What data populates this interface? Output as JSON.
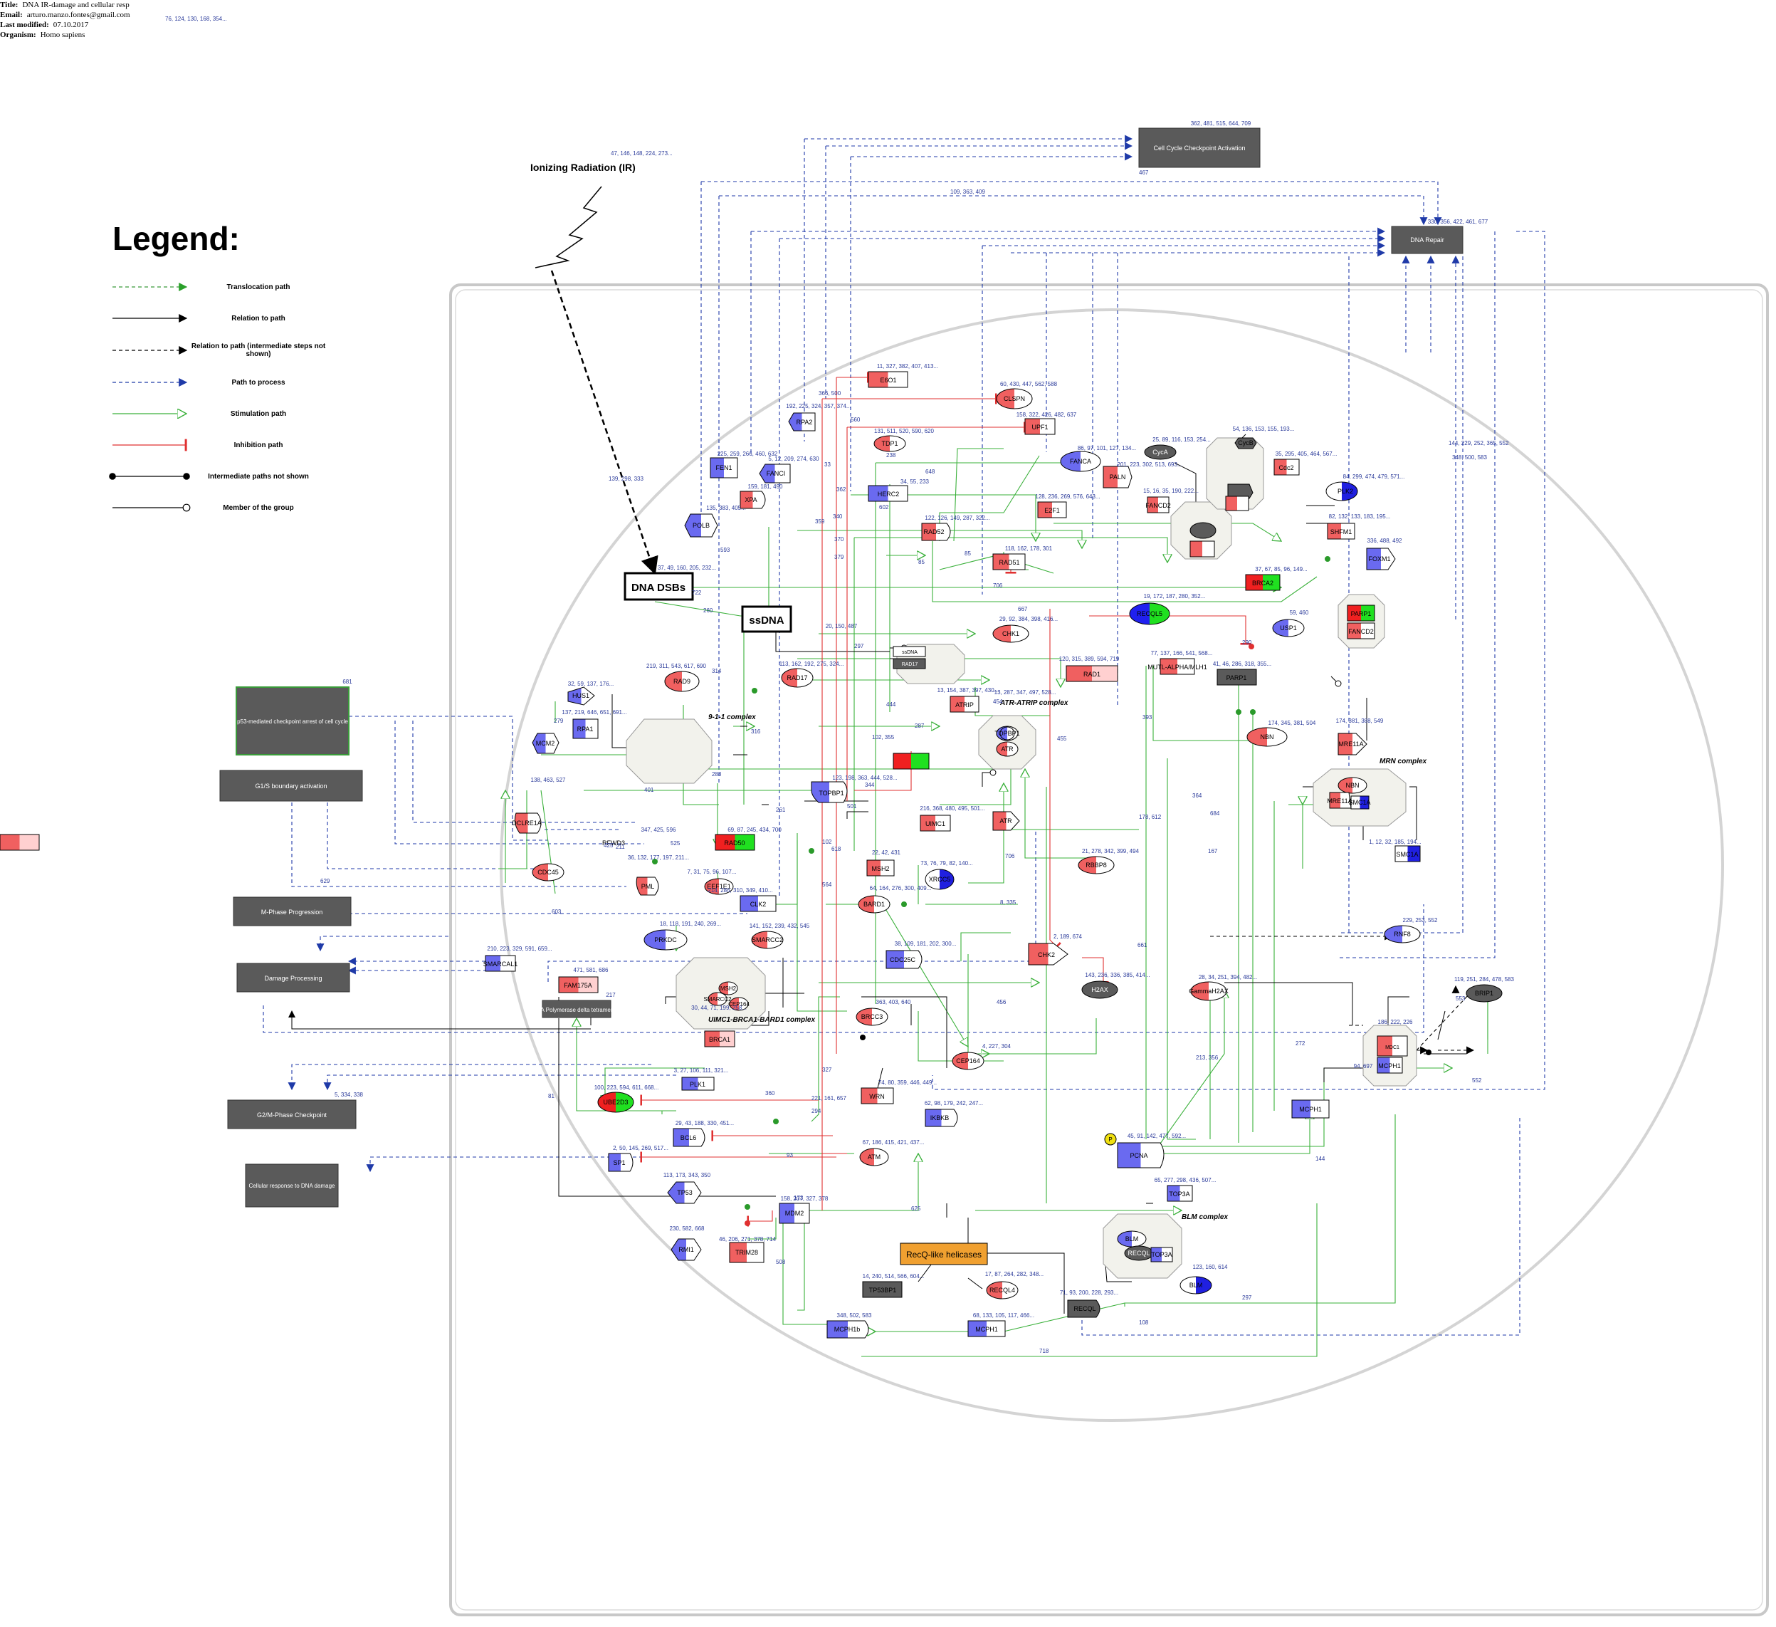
{
  "header": {
    "title_label": "Title:",
    "title": "DNA IR-damage and cellular resp",
    "email_label": "Email:",
    "email": "arturo.manzo.fontes@gmail.com",
    "modified_label": "Last modified:",
    "modified": "07.10.2017",
    "organism_label": "Organism:",
    "organism": "Homo sapiens",
    "refs": "76, 124, 130, 168, 354..."
  },
  "legend": {
    "title": "Legend:",
    "items": [
      {
        "label": "Translocation path"
      },
      {
        "label": "Relation to path"
      },
      {
        "label": "Relation to path (intermediate steps not shown)"
      },
      {
        "label": "Path to process"
      },
      {
        "label": "Stimulation path"
      },
      {
        "label": "Inhibition path"
      },
      {
        "label": "Intermediate paths not shown"
      },
      {
        "label": "Member of the group"
      }
    ]
  },
  "colors": {
    "translocation": "#3a9a3a",
    "relation": "#000000",
    "process": "#1f3aa8",
    "stimulation": "#3ab03a",
    "inhibition": "#e03030",
    "process_box": "#5a5a5a",
    "red_node": "#f06060",
    "blue_node": "#6a6af0",
    "green_node": "#20e020",
    "ref_text": "#2a3a9a"
  },
  "stimulus": {
    "label": "Ionizing Radiation (IR)",
    "refs": "47, 146, 148, 224, 273..."
  },
  "processes": [
    {
      "label": "Cell Cycle Checkpoint Activation",
      "refs": "362, 481, 515, 644, 709"
    },
    {
      "label": "DNA Repair",
      "refs": "330, 356, 422, 461, 677"
    },
    {
      "label": "p53-mediated checkpoint arrest of cell cycle",
      "refs": "681"
    },
    {
      "label": "G1/S boundary activation",
      "refs": ""
    },
    {
      "label": "M-Phase Progression",
      "refs": ""
    },
    {
      "label": "Damage Processing",
      "refs": ""
    },
    {
      "label": "G2/M-Phase Checkpoint",
      "refs": "5, 334, 338"
    },
    {
      "label": "Cellular response to DNA damage",
      "refs": ""
    },
    {
      "label": "A Polymerase delta tetramer",
      "refs": "217"
    }
  ],
  "key_nodes": [
    {
      "label": "DNA DSBs",
      "refs": "37, 49, 160, 205, 232..."
    },
    {
      "label": "ssDNA",
      "refs": ""
    },
    {
      "label": "RecQ-like helicases",
      "refs": ""
    }
  ],
  "genes": [
    {
      "label": "E2F1",
      "refs": "128, 236, 269, 576, 643..."
    },
    {
      "label": "E6O1",
      "refs": "11, 327, 382, 407, 413..."
    },
    {
      "label": "CLSPN",
      "refs": "60, 430, 447, 562, 588"
    },
    {
      "label": "UPF1",
      "refs": "158, 322, 426, 482, 637"
    },
    {
      "label": "RPA2",
      "refs": "192, 225, 324, 357, 374..."
    },
    {
      "label": "TDP1",
      "refs": "131, 511, 520, 590, 620"
    },
    {
      "label": "FEN1",
      "refs": "225, 259, 266, 460, 632"
    },
    {
      "label": "FANCI",
      "refs": "5, 12, 209, 274, 630"
    },
    {
      "label": "FANCA",
      "refs": "86, 97, 101, 127, 134..."
    },
    {
      "label": "PALN",
      "refs": "201, 223, 302, 513, 693..."
    },
    {
      "label": "HERC2",
      "refs": "34, 55, 233"
    },
    {
      "label": "XPA",
      "refs": "159, 181, 490"
    },
    {
      "label": "POLB",
      "refs": "135, 383, 405..."
    },
    {
      "label": "RAD52",
      "refs": "122, 126, 149, 287, 322..."
    },
    {
      "label": "RAD51",
      "refs": "118, 162, 178, 301"
    },
    {
      "label": "CHK1",
      "refs": "29, 92, 384, 398, 416..."
    },
    {
      "label": "RECQL5",
      "refs": "19, 172, 187, 280, 352..."
    },
    {
      "label": "USP1",
      "refs": "59, 460"
    },
    {
      "label": "BRCA2",
      "refs": "37, 67, 85, 96, 149..."
    },
    {
      "label": "FOXM1",
      "refs": "336, 488, 492"
    },
    {
      "label": "SHFM1",
      "refs": "82, 132, 133, 183, 195..."
    },
    {
      "label": "PLK2",
      "refs": "84, 299, 474, 479, 571..."
    },
    {
      "label": "Cdc2",
      "refs": "35, 295, 405, 464, 567..."
    },
    {
      "label": "CycA",
      "refs": "25, 89, 116, 153, 254..."
    },
    {
      "label": "CycB",
      "refs": "54, 136, 153, 155, 193..."
    },
    {
      "label": "Cdk2",
      "refs": "15, 16, 35, 190, 222..."
    },
    {
      "label": "FANCD2",
      "refs": "41, 46, 286, 318, 355..."
    },
    {
      "label": "PARP1",
      "refs": "77, 137, 166, 541, 568..."
    },
    {
      "label": "MUTL-ALPHA/MLH1",
      "refs": "120, 315, 389, 594, 719"
    },
    {
      "label": "RAD1",
      "refs": "219, 311, 543, 617, 690"
    },
    {
      "label": "RAD9",
      "refs": "32, 59, 137, 176..."
    },
    {
      "label": "HUS1",
      "refs": "137, 219, 646, 651, 691..."
    },
    {
      "label": "RPA1",
      "refs": "113, 162, 192, 275, 324..."
    },
    {
      "label": "RAD17",
      "refs": "13, 154, 387, 397, 430..."
    },
    {
      "label": "ATRIP",
      "refs": "13, 287, 347, 497, 528..."
    },
    {
      "label": "ATR",
      "refs": "123, 198, 363, 444, 528..."
    },
    {
      "label": "TOPBP1",
      "refs": "69, 87, 245, 434, 700"
    },
    {
      "label": "RAD50",
      "refs": "174, 381, 388, 549"
    },
    {
      "label": "MRE11A",
      "refs": "174, 345, 381, 504"
    },
    {
      "label": "NBN",
      "refs": "1, 12, 32, 185, 194..."
    },
    {
      "label": "SMC1A",
      "refs": ""
    },
    {
      "label": "MCM2",
      "refs": "138, 463, 527"
    },
    {
      "label": "DCLRE1A",
      "refs": ""
    },
    {
      "label": "RFWD3",
      "refs": "347, 425, 596"
    },
    {
      "label": "CDC45",
      "refs": "36, 132, 177, 197, 211..."
    },
    {
      "label": "PML",
      "refs": "7, 31, 75, 96, 107..."
    },
    {
      "label": "EEF1E1",
      "refs": "214, 286, 310, 349, 410..."
    },
    {
      "label": "CLK2",
      "refs": "22, 42, 431"
    },
    {
      "label": "MSH2",
      "refs": "73, 76, 79, 82, 140..."
    },
    {
      "label": "XRCC5",
      "refs": "21, 278, 342, 399, 494"
    },
    {
      "label": "RBBP8",
      "refs": "216, 368, 480, 495, 501..."
    },
    {
      "label": "UIMC1",
      "refs": "64, 164, 276, 300, 409..."
    },
    {
      "label": "BARD1",
      "refs": "141, 152, 239, 432, 545"
    },
    {
      "label": "SMARCC2",
      "refs": "18, 118, 191, 240, 269..."
    },
    {
      "label": "PRKDC",
      "refs": "210, 223, 329, 591, 659..."
    },
    {
      "label": "SMARCAL1",
      "refs": "471, 581, 686"
    },
    {
      "label": "FAM175A",
      "refs": "38, 109, 181, 202, 300..."
    },
    {
      "label": "CDC25C",
      "refs": "2, 189, 674"
    },
    {
      "label": "CHK2",
      "refs": "143, 236, 336, 385, 414..."
    },
    {
      "label": "H2AX",
      "refs": "28, 34, 251, 394, 482..."
    },
    {
      "label": "GammaH2AX",
      "refs": "186, 222, 226"
    },
    {
      "label": "MDC1",
      "refs": "94, 697"
    },
    {
      "label": "MCPH1",
      "refs": "63, 189, 270, 348, 606"
    },
    {
      "label": "RNF8",
      "refs": "229, 253, 552"
    },
    {
      "label": "BRIP1",
      "refs": "119, 251, 284, 478, 583"
    },
    {
      "label": "BRCC3",
      "refs": "363, 403, 640"
    },
    {
      "label": "BRCA1",
      "refs": "30, 44, 71, 199, 258..."
    },
    {
      "label": "CEP164",
      "refs": "4, 227, 304"
    },
    {
      "label": "PLK1",
      "refs": "3, 27, 106, 111, 321..."
    },
    {
      "label": "UBE2D3",
      "refs": "100, 223, 594, 611, 668..."
    },
    {
      "label": "WRN",
      "refs": "74, 80, 359, 446, 449..."
    },
    {
      "label": "IKBKB",
      "refs": "62, 98, 179, 242, 247..."
    },
    {
      "label": "BCL6",
      "refs": "29, 43, 188, 330, 451..."
    },
    {
      "label": "SP1",
      "refs": "2, 50, 145, 269, 517..."
    },
    {
      "label": "ATM",
      "refs": "67, 186, 415, 421, 437..."
    },
    {
      "label": "PCNA",
      "refs": "45, 91, 142, 477, 592..."
    },
    {
      "label": "TP53",
      "refs": "113, 173, 343, 350"
    },
    {
      "label": "MDM2",
      "refs": "158, 207, 327, 378"
    },
    {
      "label": "TRIM28",
      "refs": "46, 206, 271, 378, 714"
    },
    {
      "label": "RMI1",
      "refs": "230, 582, 668"
    },
    {
      "label": "TOP3A",
      "refs": "65, 277, 298, 436, 507..."
    },
    {
      "label": "BLM",
      "refs": "123, 160, 614"
    },
    {
      "label": "RECQL",
      "refs": "71, 93, 200, 228, 293..."
    },
    {
      "label": "RECQL4",
      "refs": "17, 87, 264, 282, 348..."
    },
    {
      "label": "TP53BP1",
      "refs": "14, 240, 514, 566, 604..."
    },
    {
      "label": "MCPH1b",
      "refs": "348, 502, 583"
    },
    {
      "label": "ssDNA-RPA1",
      "refs": "68, 133, 105, 117, 466..."
    },
    {
      "label": "RHNO1",
      "refs": "20, 150, 487"
    }
  ],
  "complexes": [
    {
      "label": "ATR-ATRIP complex"
    },
    {
      "label": "9-1-1 complex"
    },
    {
      "label": "MRN complex"
    },
    {
      "label": "UIMC1-BRCA1-BARD1 complex"
    },
    {
      "label": "BLM complex"
    }
  ],
  "edge_labels": [
    "139, 298, 333",
    "366, 500",
    "560",
    "33",
    "238",
    "648",
    "362",
    "340",
    "359",
    "370",
    "379",
    "602",
    "85",
    "85",
    "706",
    "667",
    "593",
    "722",
    "260",
    "314",
    "297",
    "444",
    "287",
    "316",
    "102, 355",
    "454",
    "455",
    "344",
    "501",
    "102",
    "618",
    "564",
    "261",
    "288",
    "525",
    "401",
    "425",
    "211",
    "629",
    "603",
    "8, 335",
    "706",
    "456",
    "661",
    "393",
    "364",
    "684",
    "167",
    "178, 612",
    "213, 356",
    "272",
    "553",
    "552",
    "144",
    "625",
    "508",
    "297",
    "108",
    "718",
    "93",
    "294",
    "81",
    "360",
    "221, 161, 657",
    "327",
    "173",
    "467",
    "109, 363, 409",
    "144, 229, 252, 365, 552",
    "348, 500, 583",
    "290",
    "279"
  ]
}
